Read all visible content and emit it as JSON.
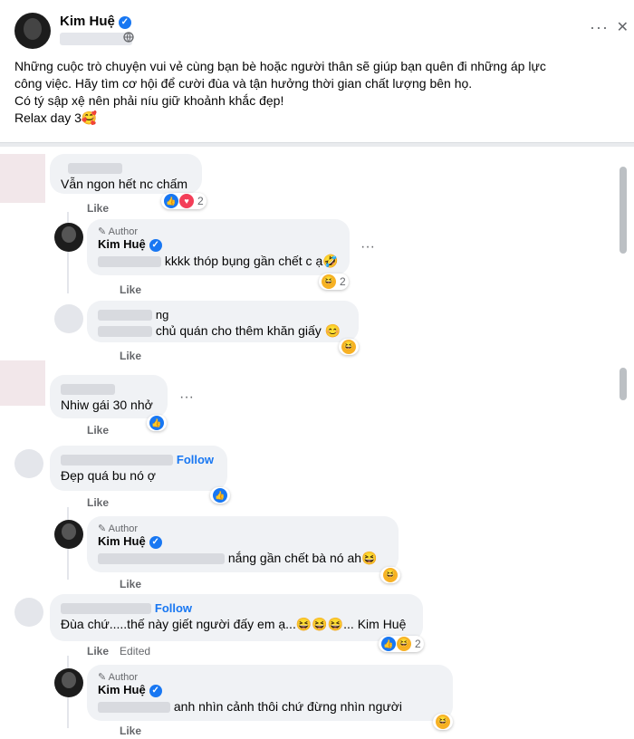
{
  "post": {
    "author": "Kim Huệ",
    "verified_icon": "✓",
    "privacy_icon": "globe-icon",
    "menu_dots": "···",
    "close": "✕",
    "lines": [
      "Những cuộc trò chuyện vui vẻ cùng bạn bè hoặc người thân sẽ giúp bạn quên đi những áp lực",
      "công việc. Hãy tìm cơ hội để cười đùa và tận hưởng thời gian chất lượng bên họ.",
      "Có tý sập xệ nên phải níu giữ khoảnh khắc đẹp!",
      "Relax day 3🥰"
    ]
  },
  "labels": {
    "like": "Like",
    "author": "Author",
    "follow": "Follow",
    "edited": "Edited",
    "more": "···"
  },
  "comments": [
    {
      "text": "Vẫn ngon hết nc chấm",
      "reaction_count": "2"
    },
    {
      "name": "Kim Huệ",
      "text": "kkkk thóp bụng gần chết c ạ🤣",
      "reaction_count": "2"
    },
    {
      "text_prefix": "ng",
      "text": "chủ quán cho thêm khăn giấy 😊"
    },
    {
      "text": "Nhiw gái 30 nhở"
    },
    {
      "text": "Đẹp quá bu nó ợ"
    },
    {
      "name": "Kim Huệ",
      "text": "nắng gần chết bà nó ah😆"
    },
    {
      "text": "Đùa chứ.....thế này giết người đấy em ạ...😆😆😆... Kim Huệ",
      "reaction_count": "2"
    },
    {
      "name": "Kim Huệ",
      "text": "anh nhìn cảnh thôi chứ đừng nhìn người"
    }
  ],
  "colors": {
    "accent": "#1877f2",
    "bubble": "#f0f2f5",
    "muted": "#65676b"
  }
}
